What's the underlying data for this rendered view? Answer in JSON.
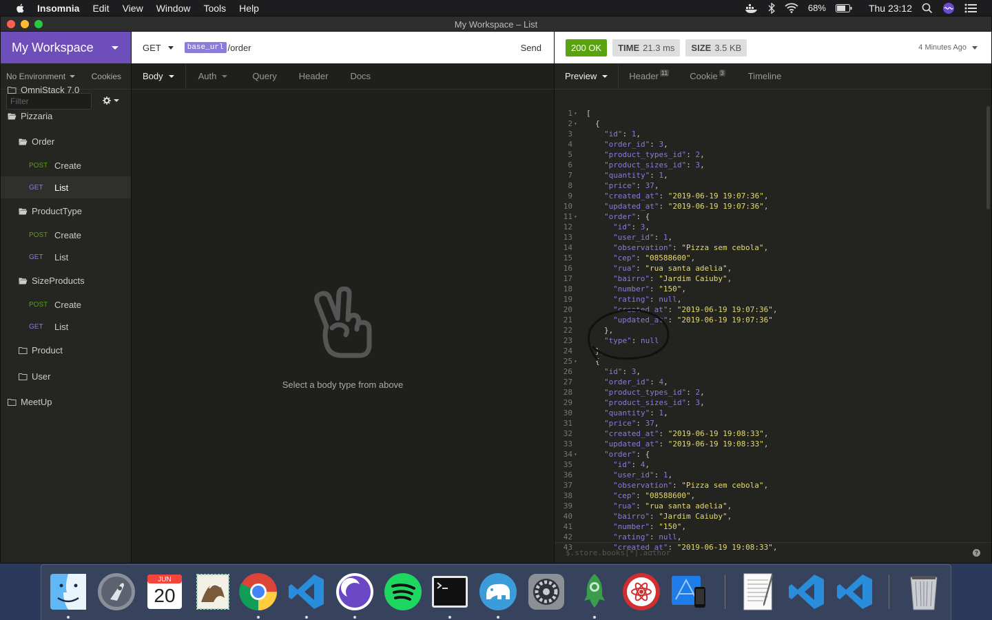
{
  "menubar": {
    "items": [
      "Insomnia",
      "Edit",
      "View",
      "Window",
      "Tools",
      "Help"
    ],
    "battery": "68%",
    "clock": "Thu 23:12"
  },
  "window": {
    "title": "My Workspace – List"
  },
  "sidebar": {
    "workspace": "My Workspace",
    "environment": "No Environment",
    "cookies": "Cookies",
    "filter_placeholder": "Filter",
    "tree": [
      {
        "type": "folder",
        "label": "OmniStack 7.0",
        "depth": 0,
        "open": false
      },
      {
        "type": "folder",
        "label": "Pizzaria",
        "depth": 0,
        "open": true
      },
      {
        "type": "folder",
        "label": "Order",
        "depth": 1,
        "open": true
      },
      {
        "type": "request",
        "method": "POST",
        "label": "Create",
        "depth": 2
      },
      {
        "type": "request",
        "method": "GET",
        "label": "List",
        "depth": 2,
        "active": true
      },
      {
        "type": "folder",
        "label": "ProductType",
        "depth": 1,
        "open": true
      },
      {
        "type": "request",
        "method": "POST",
        "label": "Create",
        "depth": 2
      },
      {
        "type": "request",
        "method": "GET",
        "label": "List",
        "depth": 2
      },
      {
        "type": "folder",
        "label": "SizeProducts",
        "depth": 1,
        "open": true
      },
      {
        "type": "request",
        "method": "POST",
        "label": "Create",
        "depth": 2
      },
      {
        "type": "request",
        "method": "GET",
        "label": "List",
        "depth": 2
      },
      {
        "type": "folder",
        "label": "Product",
        "depth": 1,
        "open": false
      },
      {
        "type": "folder",
        "label": "User",
        "depth": 1,
        "open": false
      },
      {
        "type": "folder",
        "label": "MeetUp",
        "depth": 0,
        "open": false
      }
    ]
  },
  "request": {
    "method": "GET",
    "url_var": "base_url",
    "url_path": "/order",
    "send": "Send",
    "tabs": [
      "Body",
      "Auth",
      "Query",
      "Header",
      "Docs"
    ],
    "empty_message": "Select a body type from above"
  },
  "response": {
    "status": "200 OK",
    "time_label": "TIME",
    "time_value": "21.3 ms",
    "size_label": "SIZE",
    "size_value": "3.5 KB",
    "time_ago": "4 Minutes Ago",
    "tabs": [
      {
        "label": "Preview",
        "badge": ""
      },
      {
        "label": "Header",
        "badge": "11"
      },
      {
        "label": "Cookie",
        "badge": "3"
      },
      {
        "label": "Timeline",
        "badge": ""
      }
    ],
    "filter_placeholder": "$.store.books[*].author",
    "lines": [
      {
        "n": "1",
        "fold": true,
        "ind": 0,
        "t": [
          [
            "p",
            "["
          ]
        ]
      },
      {
        "n": "2",
        "fold": true,
        "ind": 1,
        "t": [
          [
            "p",
            "{"
          ]
        ]
      },
      {
        "n": "3",
        "ind": 2,
        "t": [
          [
            "k",
            "\"id\""
          ],
          [
            "p",
            ": "
          ],
          [
            "n",
            "1"
          ],
          [
            "p",
            ","
          ]
        ]
      },
      {
        "n": "4",
        "ind": 2,
        "t": [
          [
            "k",
            "\"order_id\""
          ],
          [
            "p",
            ": "
          ],
          [
            "n",
            "3"
          ],
          [
            "p",
            ","
          ]
        ]
      },
      {
        "n": "5",
        "ind": 2,
        "t": [
          [
            "k",
            "\"product_types_id\""
          ],
          [
            "p",
            ": "
          ],
          [
            "n",
            "2"
          ],
          [
            "p",
            ","
          ]
        ]
      },
      {
        "n": "6",
        "ind": 2,
        "t": [
          [
            "k",
            "\"product_sizes_id\""
          ],
          [
            "p",
            ": "
          ],
          [
            "n",
            "3"
          ],
          [
            "p",
            ","
          ]
        ]
      },
      {
        "n": "7",
        "ind": 2,
        "t": [
          [
            "k",
            "\"quantity\""
          ],
          [
            "p",
            ": "
          ],
          [
            "n",
            "1"
          ],
          [
            "p",
            ","
          ]
        ]
      },
      {
        "n": "8",
        "ind": 2,
        "t": [
          [
            "k",
            "\"price\""
          ],
          [
            "p",
            ": "
          ],
          [
            "n",
            "37"
          ],
          [
            "p",
            ","
          ]
        ]
      },
      {
        "n": "9",
        "ind": 2,
        "t": [
          [
            "k",
            "\"created_at\""
          ],
          [
            "p",
            ": "
          ],
          [
            "s",
            "\"2019-06-19 19:07:36\""
          ],
          [
            "p",
            ","
          ]
        ]
      },
      {
        "n": "10",
        "ind": 2,
        "t": [
          [
            "k",
            "\"updated_at\""
          ],
          [
            "p",
            ": "
          ],
          [
            "s",
            "\"2019-06-19 19:07:36\""
          ],
          [
            "p",
            ","
          ]
        ]
      },
      {
        "n": "11",
        "fold": true,
        "ind": 2,
        "t": [
          [
            "k",
            "\"order\""
          ],
          [
            "p",
            ": {"
          ]
        ]
      },
      {
        "n": "12",
        "ind": 3,
        "t": [
          [
            "k",
            "\"id\""
          ],
          [
            "p",
            ": "
          ],
          [
            "n",
            "3"
          ],
          [
            "p",
            ","
          ]
        ]
      },
      {
        "n": "13",
        "ind": 3,
        "t": [
          [
            "k",
            "\"user_id\""
          ],
          [
            "p",
            ": "
          ],
          [
            "n",
            "1"
          ],
          [
            "p",
            ","
          ]
        ]
      },
      {
        "n": "14",
        "ind": 3,
        "t": [
          [
            "k",
            "\"observation\""
          ],
          [
            "p",
            ": "
          ],
          [
            "s",
            "\"Pizza sem cebola\""
          ],
          [
            "p",
            ","
          ]
        ]
      },
      {
        "n": "15",
        "ind": 3,
        "t": [
          [
            "k",
            "\"cep\""
          ],
          [
            "p",
            ": "
          ],
          [
            "s",
            "\"08588600\""
          ],
          [
            "p",
            ","
          ]
        ]
      },
      {
        "n": "16",
        "ind": 3,
        "t": [
          [
            "k",
            "\"rua\""
          ],
          [
            "p",
            ": "
          ],
          [
            "s",
            "\"rua santa adelia\""
          ],
          [
            "p",
            ","
          ]
        ]
      },
      {
        "n": "17",
        "ind": 3,
        "t": [
          [
            "k",
            "\"bairro\""
          ],
          [
            "p",
            ": "
          ],
          [
            "s",
            "\"Jardim Caiuby\""
          ],
          [
            "p",
            ","
          ]
        ]
      },
      {
        "n": "18",
        "ind": 3,
        "t": [
          [
            "k",
            "\"number\""
          ],
          [
            "p",
            ": "
          ],
          [
            "s",
            "\"150\""
          ],
          [
            "p",
            ","
          ]
        ]
      },
      {
        "n": "19",
        "ind": 3,
        "t": [
          [
            "k",
            "\"rating\""
          ],
          [
            "p",
            ": "
          ],
          [
            "n",
            "null"
          ],
          [
            "p",
            ","
          ]
        ]
      },
      {
        "n": "20",
        "ind": 3,
        "t": [
          [
            "k",
            "\"created_at\""
          ],
          [
            "p",
            ": "
          ],
          [
            "s",
            "\"2019-06-19 19:07:36\""
          ],
          [
            "p",
            ","
          ]
        ]
      },
      {
        "n": "21",
        "ind": 3,
        "t": [
          [
            "k",
            "\"updated_at\""
          ],
          [
            "p",
            ": "
          ],
          [
            "s",
            "\"2019-06-19 19:07:36\""
          ]
        ]
      },
      {
        "n": "22",
        "ind": 2,
        "t": [
          [
            "p",
            "},"
          ]
        ]
      },
      {
        "n": "23",
        "ind": 2,
        "t": [
          [
            "k",
            "\"type\""
          ],
          [
            "p",
            ": "
          ],
          [
            "n",
            "null"
          ]
        ]
      },
      {
        "n": "24",
        "ind": 1,
        "t": [
          [
            "p",
            "},"
          ]
        ]
      },
      {
        "n": "25",
        "fold": true,
        "ind": 1,
        "t": [
          [
            "p",
            "{"
          ]
        ]
      },
      {
        "n": "26",
        "ind": 2,
        "t": [
          [
            "k",
            "\"id\""
          ],
          [
            "p",
            ": "
          ],
          [
            "n",
            "3"
          ],
          [
            "p",
            ","
          ]
        ]
      },
      {
        "n": "27",
        "ind": 2,
        "t": [
          [
            "k",
            "\"order_id\""
          ],
          [
            "p",
            ": "
          ],
          [
            "n",
            "4"
          ],
          [
            "p",
            ","
          ]
        ]
      },
      {
        "n": "28",
        "ind": 2,
        "t": [
          [
            "k",
            "\"product_types_id\""
          ],
          [
            "p",
            ": "
          ],
          [
            "n",
            "2"
          ],
          [
            "p",
            ","
          ]
        ]
      },
      {
        "n": "29",
        "ind": 2,
        "t": [
          [
            "k",
            "\"product_sizes_id\""
          ],
          [
            "p",
            ": "
          ],
          [
            "n",
            "3"
          ],
          [
            "p",
            ","
          ]
        ]
      },
      {
        "n": "30",
        "ind": 2,
        "t": [
          [
            "k",
            "\"quantity\""
          ],
          [
            "p",
            ": "
          ],
          [
            "n",
            "1"
          ],
          [
            "p",
            ","
          ]
        ]
      },
      {
        "n": "31",
        "ind": 2,
        "t": [
          [
            "k",
            "\"price\""
          ],
          [
            "p",
            ": "
          ],
          [
            "n",
            "37"
          ],
          [
            "p",
            ","
          ]
        ]
      },
      {
        "n": "32",
        "ind": 2,
        "t": [
          [
            "k",
            "\"created_at\""
          ],
          [
            "p",
            ": "
          ],
          [
            "s",
            "\"2019-06-19 19:08:33\""
          ],
          [
            "p",
            ","
          ]
        ]
      },
      {
        "n": "33",
        "ind": 2,
        "t": [
          [
            "k",
            "\"updated_at\""
          ],
          [
            "p",
            ": "
          ],
          [
            "s",
            "\"2019-06-19 19:08:33\""
          ],
          [
            "p",
            ","
          ]
        ]
      },
      {
        "n": "34",
        "fold": true,
        "ind": 2,
        "t": [
          [
            "k",
            "\"order\""
          ],
          [
            "p",
            ": {"
          ]
        ]
      },
      {
        "n": "35",
        "ind": 3,
        "t": [
          [
            "k",
            "\"id\""
          ],
          [
            "p",
            ": "
          ],
          [
            "n",
            "4"
          ],
          [
            "p",
            ","
          ]
        ]
      },
      {
        "n": "36",
        "ind": 3,
        "t": [
          [
            "k",
            "\"user_id\""
          ],
          [
            "p",
            ": "
          ],
          [
            "n",
            "1"
          ],
          [
            "p",
            ","
          ]
        ]
      },
      {
        "n": "37",
        "ind": 3,
        "t": [
          [
            "k",
            "\"observation\""
          ],
          [
            "p",
            ": "
          ],
          [
            "s",
            "\"Pizza sem cebola\""
          ],
          [
            "p",
            ","
          ]
        ]
      },
      {
        "n": "38",
        "ind": 3,
        "t": [
          [
            "k",
            "\"cep\""
          ],
          [
            "p",
            ": "
          ],
          [
            "s",
            "\"08588600\""
          ],
          [
            "p",
            ","
          ]
        ]
      },
      {
        "n": "39",
        "ind": 3,
        "t": [
          [
            "k",
            "\"rua\""
          ],
          [
            "p",
            ": "
          ],
          [
            "s",
            "\"rua santa adelia\""
          ],
          [
            "p",
            ","
          ]
        ]
      },
      {
        "n": "40",
        "ind": 3,
        "t": [
          [
            "k",
            "\"bairro\""
          ],
          [
            "p",
            ": "
          ],
          [
            "s",
            "\"Jardim Caiuby\""
          ],
          [
            "p",
            ","
          ]
        ]
      },
      {
        "n": "41",
        "ind": 3,
        "t": [
          [
            "k",
            "\"number\""
          ],
          [
            "p",
            ": "
          ],
          [
            "s",
            "\"150\""
          ],
          [
            "p",
            ","
          ]
        ]
      },
      {
        "n": "42",
        "ind": 3,
        "t": [
          [
            "k",
            "\"rating\""
          ],
          [
            "p",
            ": "
          ],
          [
            "n",
            "null"
          ],
          [
            "p",
            ","
          ]
        ]
      },
      {
        "n": "43",
        "ind": 3,
        "t": [
          [
            "k",
            "\"created_at\""
          ],
          [
            "p",
            ": "
          ],
          [
            "s",
            "\"2019-06-19 19:08:33\""
          ],
          [
            "p",
            ","
          ]
        ]
      }
    ]
  },
  "dock": {
    "calendar_month": "JUN",
    "calendar_day": "20",
    "apps": [
      "finder-icon",
      "launchpad-icon",
      "calendar-icon",
      "mail-icon",
      "chrome-icon",
      "vscode-icon",
      "insomnia-icon",
      "spotify-icon",
      "terminal-icon",
      "tableplus-icon",
      "system-preferences-icon",
      "robo3t-icon",
      "reactotron-icon",
      "xcode-simulator-icon",
      "textedit-icon",
      "vscode-icon",
      "vscode-icon",
      "trash-icon"
    ]
  }
}
